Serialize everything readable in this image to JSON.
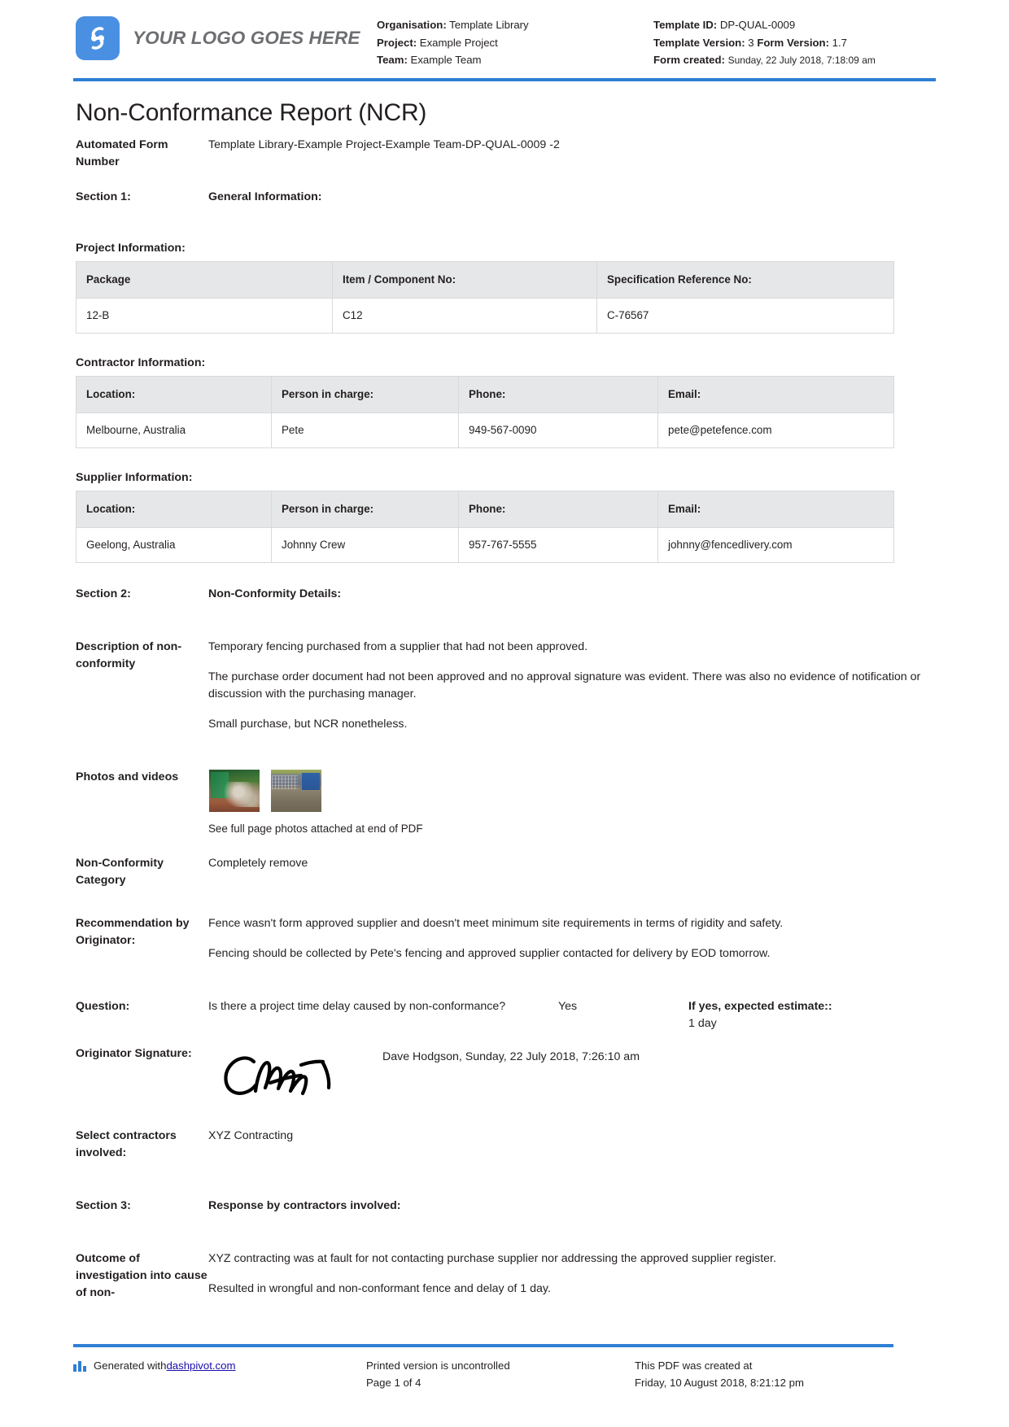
{
  "header": {
    "logo_text": "YOUR LOGO GOES HERE",
    "left_meta": [
      {
        "label": "Organisation:",
        "value": "Template Library"
      },
      {
        "label": "Project:",
        "value": "Example Project"
      },
      {
        "label": "Team:",
        "value": "Example Team"
      }
    ],
    "right_meta": {
      "template_id_label": "Template ID:",
      "template_id_value": "DP-QUAL-0009",
      "template_version_label": "Template Version:",
      "template_version_value": "3",
      "form_version_label": "Form Version:",
      "form_version_value": "1.7",
      "form_created_label": "Form created:",
      "form_created_value": "Sunday, 22 July 2018, 7:18:09 am"
    }
  },
  "title": "Non-Conformance Report (NCR)",
  "automated_form": {
    "label": "Automated Form Number",
    "value": "Template Library-Example Project-Example Team-DP-QUAL-0009   -2"
  },
  "section1": {
    "label": "Section 1:",
    "heading": "General Information:"
  },
  "project_information": {
    "heading": "Project Information:",
    "columns": [
      "Package",
      "Item / Component No:",
      "Specification Reference No:"
    ],
    "rows": [
      [
        "12-B",
        "C12",
        "C-76567"
      ]
    ]
  },
  "contractor_information": {
    "heading": "Contractor Information:",
    "columns": [
      "Location:",
      "Person in charge:",
      "Phone:",
      "Email:"
    ],
    "rows": [
      [
        "Melbourne, Australia",
        "Pete",
        "949-567-0090",
        "pete@petefence.com"
      ]
    ]
  },
  "supplier_information": {
    "heading": "Supplier Information:",
    "columns": [
      "Location:",
      "Person in charge:",
      "Phone:",
      "Email:"
    ],
    "rows": [
      [
        "Geelong, Australia",
        "Johnny Crew",
        "957-767-5555",
        "johnny@fencedlivery.com"
      ]
    ]
  },
  "section2": {
    "label": "Section 2:",
    "heading": "Non-Conformity Details:"
  },
  "description": {
    "label": "Description of non-conformity",
    "paragraphs": [
      "Temporary fencing purchased from a supplier that had not been approved.",
      "The purchase order document had not been approved and no approval signature was evident. There was also no evidence of notification or discussion with the purchasing manager.",
      "Small purchase, but NCR nonetheless."
    ]
  },
  "photos": {
    "label": "Photos and videos",
    "caption": "See full page photos attached at end of PDF"
  },
  "category": {
    "label": "Non-Conformity Category",
    "value": "Completely remove"
  },
  "recommendation": {
    "label": "Recommendation by Originator:",
    "paragraphs": [
      "Fence wasn't form approved supplier and doesn't meet minimum site requirements in terms of rigidity and safety.",
      "Fencing should be collected by Pete's fencing and approved supplier contacted for delivery by EOD tomorrow."
    ]
  },
  "question": {
    "label": "Question:",
    "text": "Is there a project time delay caused by non-conformance?",
    "answer": "Yes",
    "estimate_label": "If yes, expected estimate::",
    "estimate_value": "1 day"
  },
  "originator_signature": {
    "label": "Originator Signature:",
    "meta": "Dave Hodgson, Sunday, 22 July 2018, 7:26:10 am"
  },
  "contractors_involved": {
    "label": "Select contractors involved:",
    "value": "XYZ Contracting"
  },
  "section3": {
    "label": "Section 3:",
    "heading": "Response by contractors involved:"
  },
  "outcome": {
    "label": "Outcome of investigation into cause of non-",
    "paragraphs": [
      "XYZ contracting was at fault for not contacting purchase supplier nor addressing the approved supplier register.",
      "Resulted in wrongful and non-conformant fence and delay of 1 day."
    ]
  },
  "footer": {
    "generated_prefix": "Generated with ",
    "generated_link": "dashpivot.com",
    "printed_line1": "Printed version is uncontrolled",
    "printed_line2": "Page 1 of 4",
    "created_line1": "This PDF was created at",
    "created_line2": "Friday, 10 August 2018, 8:21:12 pm"
  },
  "colors": {
    "accent_blue": "#2e7fd4",
    "logo_blue": "#4a90e2",
    "table_header_gray": "#e6e7e8",
    "link_blue": "#1a0dab"
  }
}
